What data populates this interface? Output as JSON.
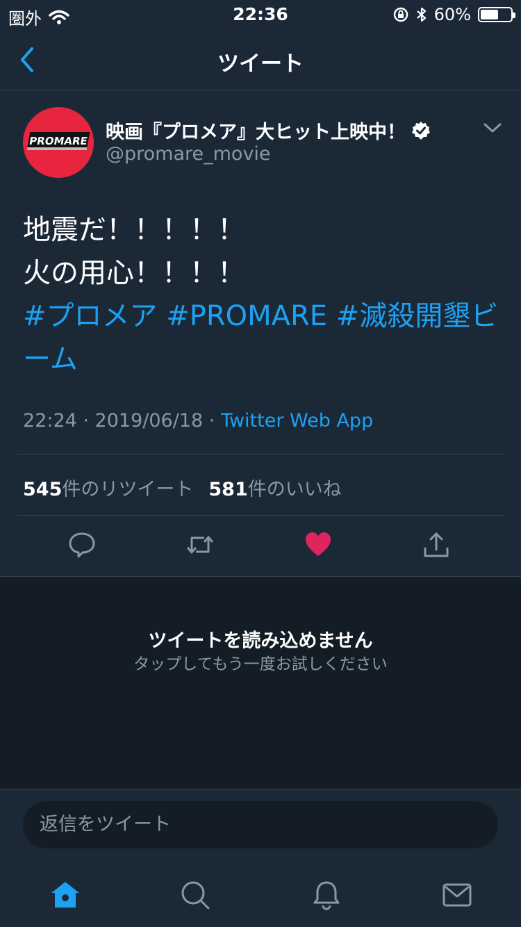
{
  "status_bar": {
    "carrier": "圏外",
    "time": "22:36",
    "battery_percent": "60%",
    "battery_level": 0.6
  },
  "nav": {
    "title": "ツイート"
  },
  "tweet": {
    "display_name": "映画『プロメア』大ヒット上映中！",
    "handle": "@promare_movie",
    "avatar_text": "PROMARE",
    "body_line1": "地震だ！！！！！",
    "body_line2": "火の用心！！！！",
    "hashtags": "#プロメア #PROMARE #滅殺開墾ビーム",
    "timestamp": "22:24 · 2019/06/18 · ",
    "source": "Twitter Web App",
    "retweets_count": "545",
    "retweets_label": "件のリツイート",
    "likes_count": "581",
    "likes_label": "件のいいね"
  },
  "empty_state": {
    "title": "ツイートを読み込めません",
    "subtitle": "タップしてもう一度お試しください"
  },
  "composer": {
    "placeholder": "返信をツイート"
  },
  "colors": {
    "accent": "#1da1f2",
    "like": "#e0245e",
    "background": "#141d26",
    "surface": "#1b2836",
    "muted": "#8899a6"
  }
}
